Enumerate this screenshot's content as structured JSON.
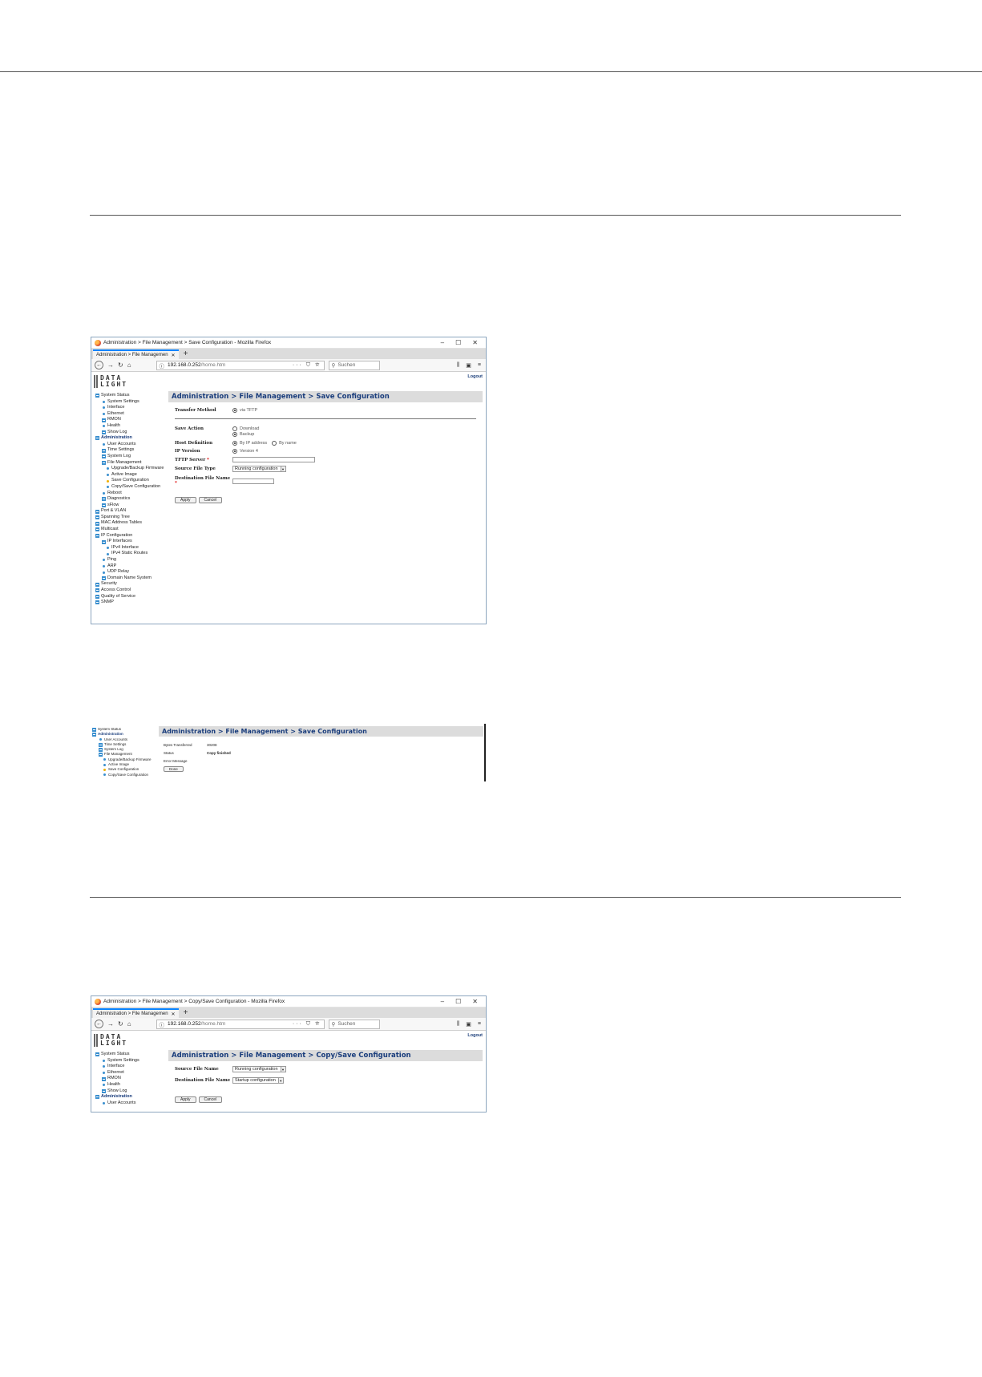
{
  "browser": {
    "url_host": "192.168.0.252",
    "url_path": "/home.htm",
    "search_placeholder": "Suchen",
    "tab_title": "Administration > File Managemen",
    "logout": "Logout",
    "logo_line1": "DATA",
    "logo_line2": "LIGHT"
  },
  "shot1": {
    "window_title": "Administration > File Management > Save Configuration - Mozilla Firefox",
    "breadcrumb": "Administration > File Management > Save Configuration",
    "sidebar": [
      {
        "label": "System Status",
        "level": 0,
        "icon": "plus-box"
      },
      {
        "label": "System Settings",
        "level": 1,
        "icon": "dot"
      },
      {
        "label": "Interface",
        "level": 1,
        "icon": "dot"
      },
      {
        "label": "Ethernet",
        "level": 1,
        "icon": "dot"
      },
      {
        "label": "RMON",
        "level": 1,
        "icon": "plus-box"
      },
      {
        "label": "Health",
        "level": 1,
        "icon": "dot"
      },
      {
        "label": "Show Log",
        "level": 1,
        "icon": "plus-box"
      },
      {
        "label": "Administration",
        "level": 0,
        "icon": "plus-box",
        "bold": true
      },
      {
        "label": "User Accounts",
        "level": 1,
        "icon": "dot"
      },
      {
        "label": "Time Settings",
        "level": 1,
        "icon": "plus-box"
      },
      {
        "label": "System Log",
        "level": 1,
        "icon": "plus-box"
      },
      {
        "label": "File Management",
        "level": 1,
        "icon": "plus-box"
      },
      {
        "label": "Upgrade/Backup Firmware",
        "level": 2,
        "icon": "dot"
      },
      {
        "label": "Active Image",
        "level": 2,
        "icon": "dot"
      },
      {
        "label": "Save Configuration",
        "level": 2,
        "icon": "dot-selected"
      },
      {
        "label": "Copy/Save Configuration",
        "level": 2,
        "icon": "dot"
      },
      {
        "label": "Reboot",
        "level": 1,
        "icon": "dot"
      },
      {
        "label": "Diagnostics",
        "level": 1,
        "icon": "plus-box"
      },
      {
        "label": "sFlow",
        "level": 1,
        "icon": "plus-box"
      },
      {
        "label": "Port & VLAN",
        "level": 0,
        "icon": "plus-box"
      },
      {
        "label": "Spanning Tree",
        "level": 0,
        "icon": "plus-box"
      },
      {
        "label": "MAC Address Tables",
        "level": 0,
        "icon": "plus-box"
      },
      {
        "label": "Multicast",
        "level": 0,
        "icon": "plus-box"
      },
      {
        "label": "IP Configuration",
        "level": 0,
        "icon": "plus-box"
      },
      {
        "label": "IP Interfaces",
        "level": 1,
        "icon": "plus-box"
      },
      {
        "label": "IPv4 Interface",
        "level": 2,
        "icon": "dot"
      },
      {
        "label": "IPv4 Static Routes",
        "level": 2,
        "icon": "dot"
      },
      {
        "label": "Ping",
        "level": 1,
        "icon": "dot"
      },
      {
        "label": "ARP",
        "level": 1,
        "icon": "dot"
      },
      {
        "label": "UDP Relay",
        "level": 1,
        "icon": "dot"
      },
      {
        "label": "Domain Name System",
        "level": 1,
        "icon": "plus-box"
      },
      {
        "label": "Security",
        "level": 0,
        "icon": "plus-box"
      },
      {
        "label": "Access Control",
        "level": 0,
        "icon": "plus-box"
      },
      {
        "label": "Quality of Service",
        "level": 0,
        "icon": "plus-box"
      },
      {
        "label": "SNMP",
        "level": 0,
        "icon": "plus-box"
      }
    ],
    "form": {
      "transfer_method_label": "Transfer Method",
      "transfer_method_value": "via TFTP",
      "save_action_label": "Save Action",
      "save_action_download": "Download",
      "save_action_backup": "Backup",
      "host_definition_label": "Host Definition",
      "host_by_ip": "By IP address",
      "host_by_name": "By name",
      "ip_version_label": "IP Version",
      "ip_version_value": "Version 4",
      "tftp_server_label": "TFTP Server",
      "source_file_type_label": "Source File Type",
      "source_file_type_value": "Running configuration",
      "destination_file_name_label": "Destination File Name",
      "required_mark": "*",
      "apply": "Apply",
      "cancel": "Cancel"
    }
  },
  "shot2": {
    "sidebar": [
      {
        "label": "System Status",
        "level": 0,
        "icon": "plus-box"
      },
      {
        "label": "Administration",
        "level": 0,
        "icon": "plus-box",
        "bold": true
      },
      {
        "label": "User Accounts",
        "level": 1,
        "icon": "dot"
      },
      {
        "label": "Time Settings",
        "level": 1,
        "icon": "plus-box"
      },
      {
        "label": "System Log",
        "level": 1,
        "icon": "plus-box"
      },
      {
        "label": "File Management",
        "level": 1,
        "icon": "plus-box"
      },
      {
        "label": "Upgrade/Backup Firmware",
        "level": 2,
        "icon": "dot"
      },
      {
        "label": "Active Image",
        "level": 2,
        "icon": "dot"
      },
      {
        "label": "Save Configuration",
        "level": 2,
        "icon": "dot-selected"
      },
      {
        "label": "Copy/Save Configuration",
        "level": 2,
        "icon": "dot"
      }
    ],
    "breadcrumb": "Administration > File Management > Save Configuration",
    "bytes_transferred_label": "Bytes Transferred",
    "bytes_transferred_value": "30208",
    "status_label": "Status",
    "status_value": "Copy finished",
    "error_message_label": "Error Message",
    "done": "Done"
  },
  "shot3": {
    "window_title": "Administration > File Management > Copy/Save Configuration - Mozilla Firefox",
    "breadcrumb": "Administration > File Management > Copy/Save Configuration",
    "sidebar": [
      {
        "label": "System Status",
        "level": 0,
        "icon": "plus-box"
      },
      {
        "label": "System Settings",
        "level": 1,
        "icon": "dot"
      },
      {
        "label": "Interface",
        "level": 1,
        "icon": "dot"
      },
      {
        "label": "Ethernet",
        "level": 1,
        "icon": "dot"
      },
      {
        "label": "RMON",
        "level": 1,
        "icon": "plus-box"
      },
      {
        "label": "Health",
        "level": 1,
        "icon": "dot"
      },
      {
        "label": "Show Log",
        "level": 1,
        "icon": "plus-box"
      },
      {
        "label": "Administration",
        "level": 0,
        "icon": "plus-box",
        "bold": true
      },
      {
        "label": "User Accounts",
        "level": 1,
        "icon": "dot"
      }
    ],
    "source_file_name_label": "Source File Name",
    "source_file_name_value": "Running configuration",
    "destination_file_name_label": "Destination File Name",
    "destination_file_name_value": "Startup configuration",
    "apply": "Apply",
    "cancel": "Cancel"
  }
}
